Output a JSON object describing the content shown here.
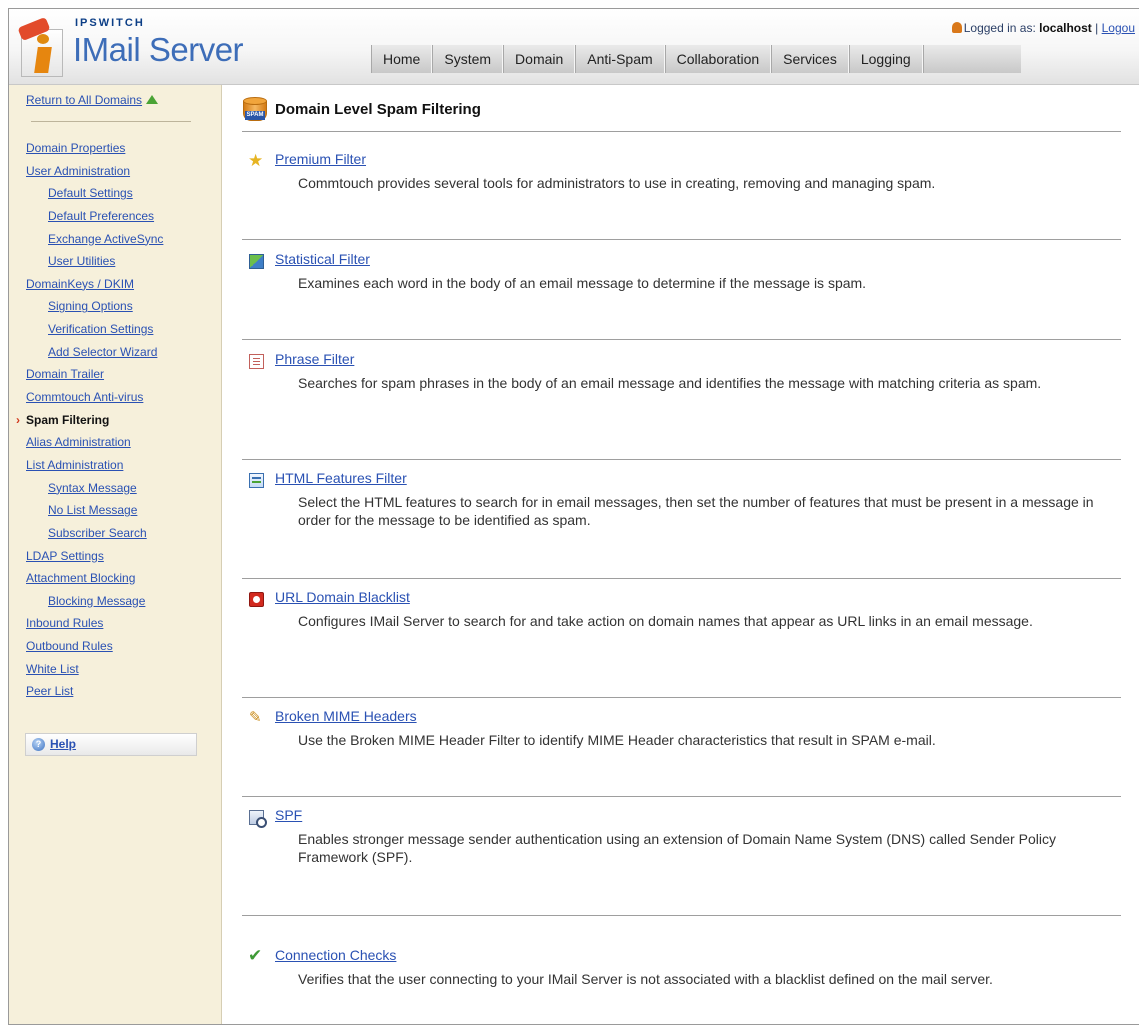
{
  "header": {
    "brand_top": "IPSWITCH",
    "brand_name": "IMail Server",
    "login_prefix": "Logged in as:",
    "login_user": "localhost",
    "login_sep": "|",
    "logout_label": "Logou"
  },
  "nav": [
    "Home",
    "System",
    "Domain",
    "Anti-Spam",
    "Collaboration",
    "Services",
    "Logging"
  ],
  "sidebar": {
    "return_label": "Return to All Domains",
    "items": [
      {
        "label": "Domain Properties",
        "level": 1
      },
      {
        "label": "User Administration",
        "level": 1
      },
      {
        "label": "Default Settings",
        "level": 2
      },
      {
        "label": "Default Preferences",
        "level": 2
      },
      {
        "label": "Exchange ActiveSync",
        "level": 2
      },
      {
        "label": "User Utilities",
        "level": 2
      },
      {
        "label": "DomainKeys / DKIM",
        "level": 1
      },
      {
        "label": "Signing Options",
        "level": 2
      },
      {
        "label": "Verification Settings",
        "level": 2
      },
      {
        "label": "Add Selector Wizard",
        "level": 2
      },
      {
        "label": "Domain Trailer",
        "level": 1
      },
      {
        "label": "Commtouch Anti-virus",
        "level": 1
      },
      {
        "label": "Spam Filtering",
        "level": 1,
        "active": true
      },
      {
        "label": "Alias Administration",
        "level": 1
      },
      {
        "label": "List Administration",
        "level": 1
      },
      {
        "label": "Syntax Message",
        "level": 2
      },
      {
        "label": "No List Message",
        "level": 2
      },
      {
        "label": "Subscriber Search",
        "level": 2
      },
      {
        "label": "LDAP Settings",
        "level": 1
      },
      {
        "label": "Attachment Blocking",
        "level": 1
      },
      {
        "label": "Blocking Message",
        "level": 2
      },
      {
        "label": "Inbound Rules",
        "level": 1
      },
      {
        "label": "Outbound Rules",
        "level": 1
      },
      {
        "label": "White List",
        "level": 1
      },
      {
        "label": "Peer List",
        "level": 1
      }
    ],
    "help_label": "Help"
  },
  "main": {
    "title": "Domain Level Spam Filtering",
    "icon_label": "SPAM",
    "sections": [
      {
        "title": "Premium Filter",
        "icon": "star-icon",
        "desc": "Commtouch provides several tools for administrators to use in creating, removing and managing spam."
      },
      {
        "title": "Statistical Filter",
        "icon": "chart-icon",
        "desc": "Examines each word in the body of an email message to determine if the message is spam."
      },
      {
        "title": "Phrase Filter",
        "icon": "document-icon",
        "desc": "Searches for spam phrases in the body of an email message and identifies the message with matching criteria as spam."
      },
      {
        "title": "HTML Features Filter",
        "icon": "html-icon",
        "desc": "Select the HTML features to search for in email messages, then set the number of features that must be present in a message in order for the message to be identified as spam."
      },
      {
        "title": "URL Domain Blacklist",
        "icon": "url-block-icon",
        "desc": "Configures IMail Server to search for and take action on domain names that appear as URL links in an email message."
      },
      {
        "title": "Broken MIME Headers",
        "icon": "mime-header-icon",
        "desc": "Use the Broken MIME Header Filter to identify MIME Header characteristics that result in SPAM e-mail."
      },
      {
        "title": "SPF",
        "icon": "spf-icon",
        "desc": "Enables stronger message sender authentication using an extension of Domain Name System (DNS) called Sender Policy Framework (SPF)."
      },
      {
        "title": "Connection Checks",
        "icon": "checkmark-icon",
        "desc": "Verifies that the user connecting to your IMail Server is not associated with a blacklist defined on the mail server."
      }
    ]
  }
}
